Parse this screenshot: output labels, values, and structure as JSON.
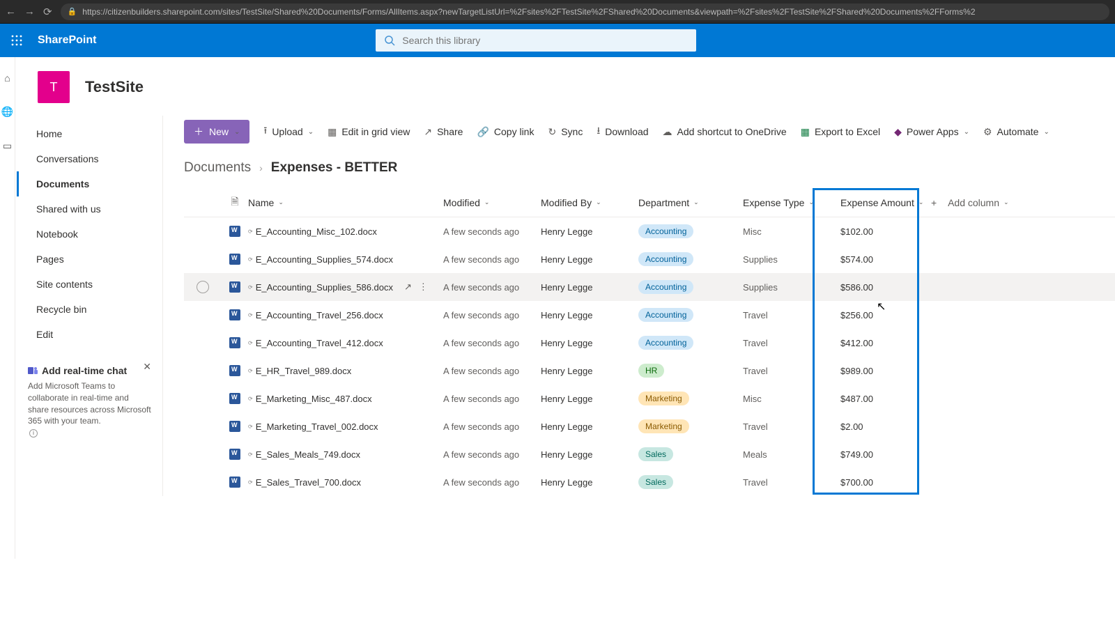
{
  "browser": {
    "url": "https://citizenbuilders.sharepoint.com/sites/TestSite/Shared%20Documents/Forms/AllItems.aspx?newTargetListUrl=%2Fsites%2FTestSite%2FShared%20Documents&viewpath=%2Fsites%2FTestSite%2FShared%20Documents%2FForms%2"
  },
  "suite": {
    "brand": "SharePoint",
    "search_placeholder": "Search this library"
  },
  "site": {
    "logo_letter": "T",
    "title": "TestSite"
  },
  "nav": {
    "items": [
      "Home",
      "Conversations",
      "Documents",
      "Shared with us",
      "Notebook",
      "Pages",
      "Site contents",
      "Recycle bin",
      "Edit"
    ],
    "active_index": 2
  },
  "teaching": {
    "title": "Add real-time chat",
    "body": "Add Microsoft Teams to collaborate in real-time and share resources across Microsoft 365 with your team."
  },
  "commands": {
    "new": "New",
    "upload": "Upload",
    "edit_grid": "Edit in grid view",
    "share": "Share",
    "copy_link": "Copy link",
    "sync": "Sync",
    "download": "Download",
    "shortcut": "Add shortcut to OneDrive",
    "export": "Export to Excel",
    "power_apps": "Power Apps",
    "automate": "Automate"
  },
  "breadcrumb": {
    "root": "Documents",
    "current": "Expenses - BETTER"
  },
  "columns": {
    "name": "Name",
    "modified": "Modified",
    "modified_by": "Modified By",
    "department": "Department",
    "expense_type": "Expense Type",
    "expense_amount": "Expense Amount",
    "add_column": "Add column"
  },
  "rows": [
    {
      "name": "E_Accounting_Misc_102.docx",
      "modified": "A few seconds ago",
      "modified_by": "Henry Legge",
      "department": "Accounting",
      "dept_class": "accounting",
      "type": "Misc",
      "amount": "$102.00",
      "hover": false
    },
    {
      "name": "E_Accounting_Supplies_574.docx",
      "modified": "A few seconds ago",
      "modified_by": "Henry Legge",
      "department": "Accounting",
      "dept_class": "accounting",
      "type": "Supplies",
      "amount": "$574.00",
      "hover": false
    },
    {
      "name": "E_Accounting_Supplies_586.docx",
      "modified": "A few seconds ago",
      "modified_by": "Henry Legge",
      "department": "Accounting",
      "dept_class": "accounting",
      "type": "Supplies",
      "amount": "$586.00",
      "hover": true
    },
    {
      "name": "E_Accounting_Travel_256.docx",
      "modified": "A few seconds ago",
      "modified_by": "Henry Legge",
      "department": "Accounting",
      "dept_class": "accounting",
      "type": "Travel",
      "amount": "$256.00",
      "hover": false
    },
    {
      "name": "E_Accounting_Travel_412.docx",
      "modified": "A few seconds ago",
      "modified_by": "Henry Legge",
      "department": "Accounting",
      "dept_class": "accounting",
      "type": "Travel",
      "amount": "$412.00",
      "hover": false
    },
    {
      "name": "E_HR_Travel_989.docx",
      "modified": "A few seconds ago",
      "modified_by": "Henry Legge",
      "department": "HR",
      "dept_class": "hr",
      "type": "Travel",
      "amount": "$989.00",
      "hover": false
    },
    {
      "name": "E_Marketing_Misc_487.docx",
      "modified": "A few seconds ago",
      "modified_by": "Henry Legge",
      "department": "Marketing",
      "dept_class": "marketing",
      "type": "Misc",
      "amount": "$487.00",
      "hover": false
    },
    {
      "name": "E_Marketing_Travel_002.docx",
      "modified": "A few seconds ago",
      "modified_by": "Henry Legge",
      "department": "Marketing",
      "dept_class": "marketing",
      "type": "Travel",
      "amount": "$2.00",
      "hover": false
    },
    {
      "name": "E_Sales_Meals_749.docx",
      "modified": "A few seconds ago",
      "modified_by": "Henry Legge",
      "department": "Sales",
      "dept_class": "sales",
      "type": "Meals",
      "amount": "$749.00",
      "hover": false
    },
    {
      "name": "E_Sales_Travel_700.docx",
      "modified": "A few seconds ago",
      "modified_by": "Henry Legge",
      "department": "Sales",
      "dept_class": "sales",
      "type": "Travel",
      "amount": "$700.00",
      "hover": false
    }
  ]
}
